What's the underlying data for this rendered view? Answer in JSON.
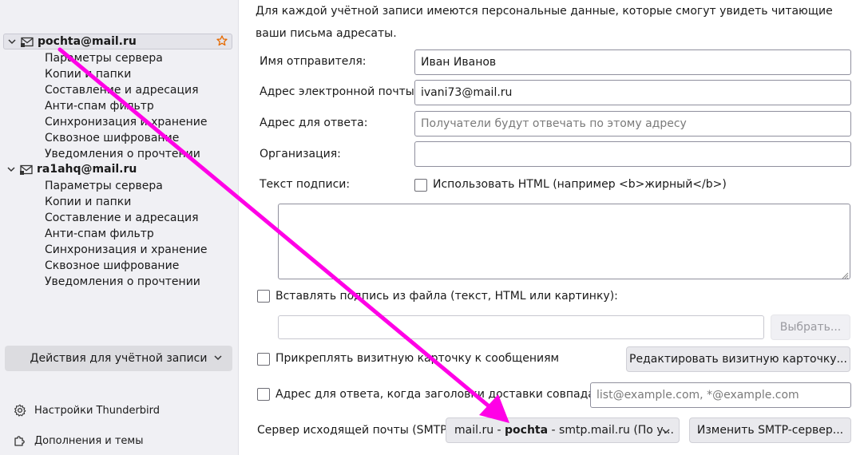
{
  "sidebar": {
    "accounts": [
      {
        "name": "pochta@mail.ru",
        "selected": true,
        "default_star": true,
        "items": [
          "Параметры сервера",
          "Копии и папки",
          "Составление и адресация",
          "Анти-спам фильтр",
          "Синхронизация и хранение",
          "Сквозное шифрование",
          "Уведомления о прочтении"
        ]
      },
      {
        "name": "ra1ahq@mail.ru",
        "selected": false,
        "default_star": false,
        "items": [
          "Параметры сервера",
          "Копии и папки",
          "Составление и адресация",
          "Анти-спам фильтр",
          "Синхронизация и хранение",
          "Сквозное шифрование",
          "Уведомления о прочтении"
        ]
      }
    ],
    "actions_label": "Действия для учётной записи",
    "settings_label": "Настройки Thunderbird",
    "addons_label": "Дополнения и темы"
  },
  "main": {
    "description": "Для каждой учётной записи имеются персональные данные, которые смогут увидеть читающие ваши письма адресаты.",
    "sender_name": {
      "label": "Имя отправителя:",
      "value": "Иван Иванов"
    },
    "email": {
      "label": "Адрес электронной почты:",
      "value": "ivani73@mail.ru"
    },
    "reply_to": {
      "label": "Адрес для ответа:",
      "placeholder": "Получатели будут отвечать по этому адресу"
    },
    "organization": {
      "label": "Организация:",
      "value": ""
    },
    "signature": {
      "label": "Текст подписи:",
      "use_html_label": "Использовать HTML (например <b>жирный</b>)",
      "use_html_checked": false,
      "text": ""
    },
    "sig_from_file": {
      "label": "Вставлять подпись из файла (текст, HTML или картинку):",
      "checked": false,
      "path": "",
      "choose_label": "Выбрать..."
    },
    "vcard": {
      "label": "Прикреплять визитную карточку к сообщениям",
      "checked": false,
      "edit_label": "Редактировать визитную карточку..."
    },
    "reply_match": {
      "label": "Адрес для ответа, когда заголовки доставки совпадают:",
      "checked": false,
      "placeholder": "list@example.com, *@example.com"
    },
    "smtp": {
      "label": "Сервер исходящей почты (SMTP)",
      "value_prefix": "mail.ru - ",
      "value_bold": "pochta",
      "value_suffix": " - smtp.mail.ru (По у...",
      "edit_label": "Изменить SMTP-сервер..."
    }
  },
  "annotation": {
    "arrow_color": "#ff00e6"
  },
  "colors": {
    "sidebar_bg": "#f0f0f4",
    "button_bg": "#e9e9ed",
    "star": "#e66a00"
  }
}
